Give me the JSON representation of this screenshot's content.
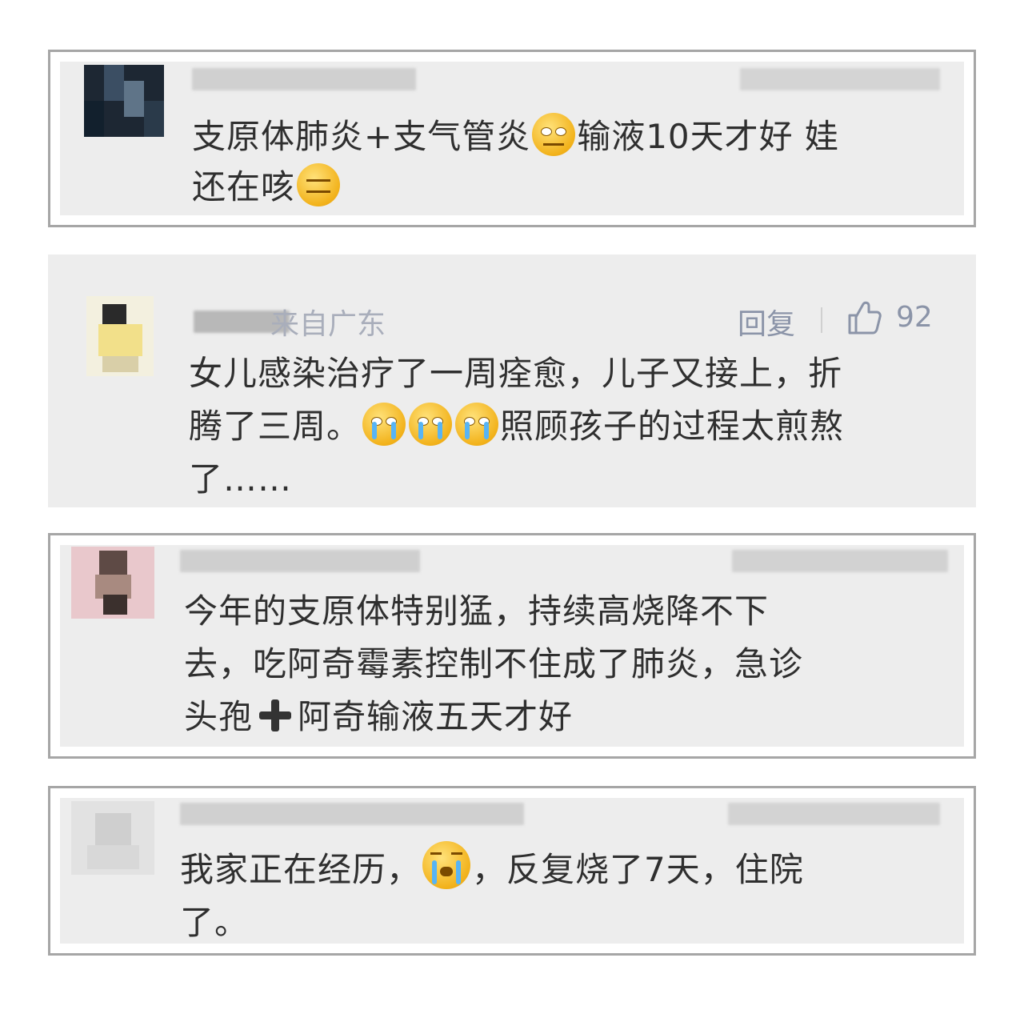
{
  "comments": [
    {
      "text_parts": [
        "支原体肺炎+支气管炎",
        "输液10天才好 娃",
        "还在咳"
      ],
      "emojis": [
        "rolling-eyes-emoji",
        "expressionless-emoji"
      ]
    },
    {
      "location": "来自广东",
      "reply_label": "回复",
      "like_count": "92",
      "text_parts": [
        "女儿感染治疗了一周痊愈，儿子又接上，折",
        "腾了三周。",
        "照顾孩子的过程太煎熬",
        "了……"
      ],
      "emojis": [
        "crying-emoji",
        "crying-emoji",
        "crying-emoji"
      ]
    },
    {
      "text_parts": [
        "今年的支原体特别猛，持续高烧降不下",
        "去，吃阿奇霉素控制不住成了肺炎，急诊",
        "头孢",
        "阿奇输液五天才好"
      ],
      "emojis": [
        "plus-icon"
      ]
    },
    {
      "text_parts": [
        "我家正在经历，",
        "，反复烧了7天，住院",
        "了。"
      ],
      "emojis": [
        "loudly-crying-emoji"
      ]
    }
  ],
  "colors": {
    "card_bg": "#ededed",
    "border": "#a6a6a6",
    "meta": "#8b94a8",
    "text": "#2f2f2f"
  }
}
